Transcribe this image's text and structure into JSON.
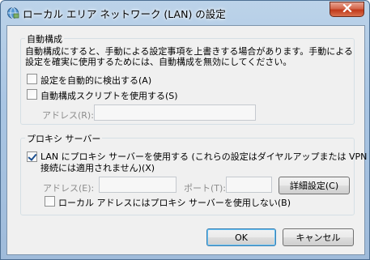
{
  "window": {
    "title": "ローカル エリア ネットワーク (LAN) の設定"
  },
  "auto_config": {
    "group_label": "自動構成",
    "description_line1": "自動構成にすると、手動による設定事項を上書きする場合があります。手動による",
    "description_line2": "設定を確実に使用するためには、自動構成を無効にしてください。",
    "auto_detect_label": "設定を自動的に検出する(A)",
    "auto_detect_checked": false,
    "use_script_label": "自動構成スクリプトを使用する(S)",
    "use_script_checked": false,
    "address_label": "アドレス(R):",
    "address_value": ""
  },
  "proxy": {
    "group_label": "プロキシ サーバー",
    "use_proxy_label_line1": "LAN にプロキシ サーバーを使用する (これらの設定はダイヤルアップまたは VPN",
    "use_proxy_label_line2": "接続には適用されません)(X)",
    "use_proxy_checked": true,
    "address_label": "アドレス(E):",
    "address_value": "",
    "port_label": "ポート(T):",
    "port_value": "",
    "advanced_button": "詳細設定(C)",
    "bypass_local_label": "ローカル アドレスにはプロキシ サーバーを使用しない(B)",
    "bypass_local_checked": false
  },
  "buttons": {
    "ok": "OK",
    "cancel": "キャンセル"
  },
  "colors": {
    "close_button": "#c7432a",
    "window_frame": "#a9c5e3",
    "checkbox_accent": "#1c4f8f"
  }
}
